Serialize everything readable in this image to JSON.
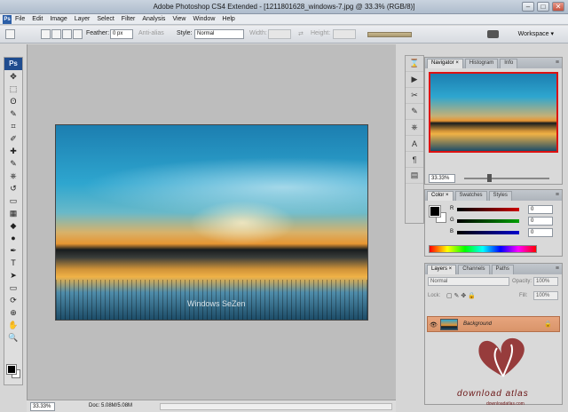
{
  "window": {
    "title": "Adobe Photoshop CS4 Extended - [1211801628_windows-7.jpg @ 33.3% (RGB/8)]",
    "controls": {
      "minimize": "–",
      "maximize": "□",
      "close": "✕"
    }
  },
  "menubar": {
    "app_badge": "Ps",
    "items": [
      "File",
      "Edit",
      "Image",
      "Layer",
      "Select",
      "Filter",
      "Analysis",
      "View",
      "Window",
      "Help"
    ]
  },
  "options_bar": {
    "feather_label": "Feather:",
    "feather_value": "0 px",
    "antialias_label": "Anti-alias",
    "style_label": "Style:",
    "style_value": "Normal",
    "width_label": "Width:",
    "height_label": "Height:",
    "workspace_label": "Workspace ▾"
  },
  "document": {
    "watermark": "Windows SeZen",
    "zoom": "33.33%",
    "doc_info": "Doc: 5.08M/5.08M"
  },
  "toolbox": {
    "logo": "Ps",
    "tools": [
      "move-tool",
      "marquee-tool",
      "lasso-tool",
      "quick-select-tool",
      "crop-tool",
      "eyedropper-tool",
      "healing-brush-tool",
      "brush-tool",
      "clone-stamp-tool",
      "history-brush-tool",
      "eraser-tool",
      "gradient-tool",
      "blur-tool",
      "dodge-tool",
      "pen-tool",
      "type-tool",
      "path-select-tool",
      "shape-tool",
      "3d-rotate-tool",
      "3d-orbit-tool",
      "hand-tool",
      "zoom-tool"
    ],
    "tool_glyphs": [
      "✥",
      "⬚",
      "ʘ",
      "✎",
      "⌗",
      "✐",
      "✚",
      "✎",
      "⎈",
      "↺",
      "▭",
      "▦",
      "◆",
      "●",
      "✒",
      "T",
      "➤",
      "▭",
      "⟳",
      "⊕",
      "✋",
      "🔍"
    ]
  },
  "dock": {
    "icons": [
      "history-icon",
      "actions-icon",
      "tools-presets-icon",
      "brushes-icon",
      "clone-source-icon",
      "character-icon",
      "paragraph-icon",
      "info-icon"
    ],
    "glyphs": [
      "⌛",
      "▶",
      "✂",
      "✎",
      "⎈",
      "A",
      "¶",
      "▤"
    ]
  },
  "navigator": {
    "tabs": [
      "Navigator ×",
      "Histogram",
      "Info"
    ],
    "zoom": "33.33%",
    "zoom_level": 0.33,
    "menu": "≡"
  },
  "color_panel": {
    "tabs": [
      "Color ×",
      "Swatches",
      "Styles"
    ],
    "menu": "≡",
    "channels": [
      {
        "label": "R",
        "value": "0",
        "color": "#cc0000"
      },
      {
        "label": "G",
        "value": "0",
        "color": "#00a000"
      },
      {
        "label": "B",
        "value": "0",
        "color": "#0000cc"
      }
    ]
  },
  "layers_panel": {
    "tabs": [
      "Layers ×",
      "Channels",
      "Paths"
    ],
    "menu": "≡",
    "blend_mode": "Normal",
    "opacity_label": "Opacity:",
    "opacity_value": "100%",
    "lock_label": "Lock:",
    "fill_label": "Fill:",
    "fill_value": "100%",
    "layer": {
      "name": "Background",
      "visible": true,
      "locked": true
    }
  },
  "branding": {
    "logo_text": "download atlas",
    "logo_sub": "downloadatlas.com",
    "color": "#6a1414"
  }
}
